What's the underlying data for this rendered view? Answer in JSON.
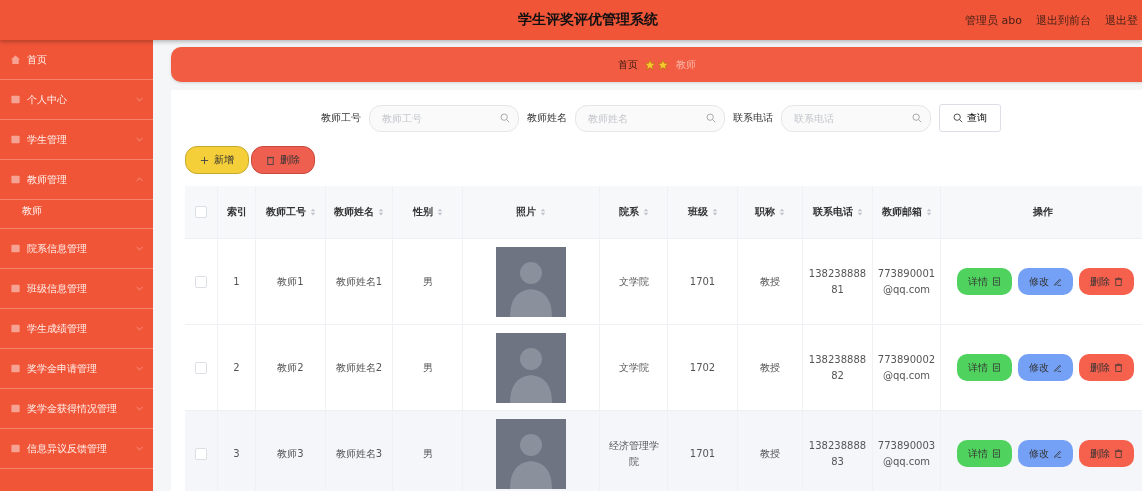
{
  "header": {
    "title": "学生评奖评优管理系统",
    "user": "管理员 abo",
    "links": [
      "退出到前台",
      "退出登"
    ]
  },
  "sidebar": {
    "items": [
      {
        "label": "首页",
        "kind": "link"
      },
      {
        "label": "个人中心",
        "kind": "menu",
        "expanded": false
      },
      {
        "label": "学生管理",
        "kind": "menu",
        "expanded": false
      },
      {
        "label": "教师管理",
        "kind": "menu",
        "expanded": true,
        "children": [
          {
            "label": "教师"
          }
        ]
      },
      {
        "label": "院系信息管理",
        "kind": "menu",
        "expanded": false
      },
      {
        "label": "班级信息管理",
        "kind": "menu",
        "expanded": false
      },
      {
        "label": "学生成绩管理",
        "kind": "menu",
        "expanded": false
      },
      {
        "label": "奖学金申请管理",
        "kind": "menu",
        "expanded": false
      },
      {
        "label": "奖学金获得情况管理",
        "kind": "menu",
        "expanded": false
      },
      {
        "label": "信息异议反馈管理",
        "kind": "menu",
        "expanded": false
      }
    ]
  },
  "breadcrumb": [
    "首页",
    "教师"
  ],
  "search": {
    "fields": [
      {
        "label": "教师工号",
        "placeholder": "教师工号"
      },
      {
        "label": "教师姓名",
        "placeholder": "教师姓名"
      },
      {
        "label": "联系电话",
        "placeholder": "联系电话"
      }
    ],
    "button": "查询"
  },
  "actions": [
    {
      "label": "新增",
      "kind": "add"
    },
    {
      "label": "删除",
      "kind": "delete"
    }
  ],
  "table": {
    "select_all_checked": false,
    "columns": [
      {
        "label": "索引",
        "sortable": false
      },
      {
        "label": "教师工号",
        "sortable": true
      },
      {
        "label": "教师姓名",
        "sortable": true
      },
      {
        "label": "性别",
        "sortable": true
      },
      {
        "label": "照片",
        "sortable": true
      },
      {
        "label": "院系",
        "sortable": true
      },
      {
        "label": "班级",
        "sortable": true
      },
      {
        "label": "职称",
        "sortable": true
      },
      {
        "label": "联系电话",
        "sortable": true
      },
      {
        "label": "教师邮箱",
        "sortable": true
      },
      {
        "label": "操作",
        "sortable": false
      }
    ],
    "rows": [
      {
        "checked": false,
        "index": "1",
        "id": "教师1",
        "name": "教师姓名1",
        "gender": "男",
        "dept": "文学院",
        "class": "1701",
        "title": "教授",
        "phone": "13823888881",
        "email": "773890001@qq.com",
        "buttons": [
          {
            "label": "详情",
            "kind": "detail"
          },
          {
            "label": "修改",
            "kind": "edit"
          },
          {
            "label": "删除",
            "kind": "delete"
          }
        ]
      },
      {
        "checked": false,
        "index": "2",
        "id": "教师2",
        "name": "教师姓名2",
        "gender": "男",
        "dept": "文学院",
        "class": "1702",
        "title": "教授",
        "phone": "13823888882",
        "email": "773890002@qq.com",
        "buttons": [
          {
            "label": "详情",
            "kind": "detail"
          },
          {
            "label": "修改",
            "kind": "edit"
          },
          {
            "label": "删除",
            "kind": "delete"
          }
        ]
      },
      {
        "checked": false,
        "index": "3",
        "id": "教师3",
        "name": "教师姓名3",
        "gender": "男",
        "dept": "经济管理学院",
        "class": "1701",
        "title": "教授",
        "phone": "13823888883",
        "email": "773890003@qq.com",
        "buttons": [
          {
            "label": "详情",
            "kind": "detail"
          },
          {
            "label": "修改",
            "kind": "edit"
          },
          {
            "label": "删除",
            "kind": "delete"
          }
        ]
      }
    ]
  }
}
